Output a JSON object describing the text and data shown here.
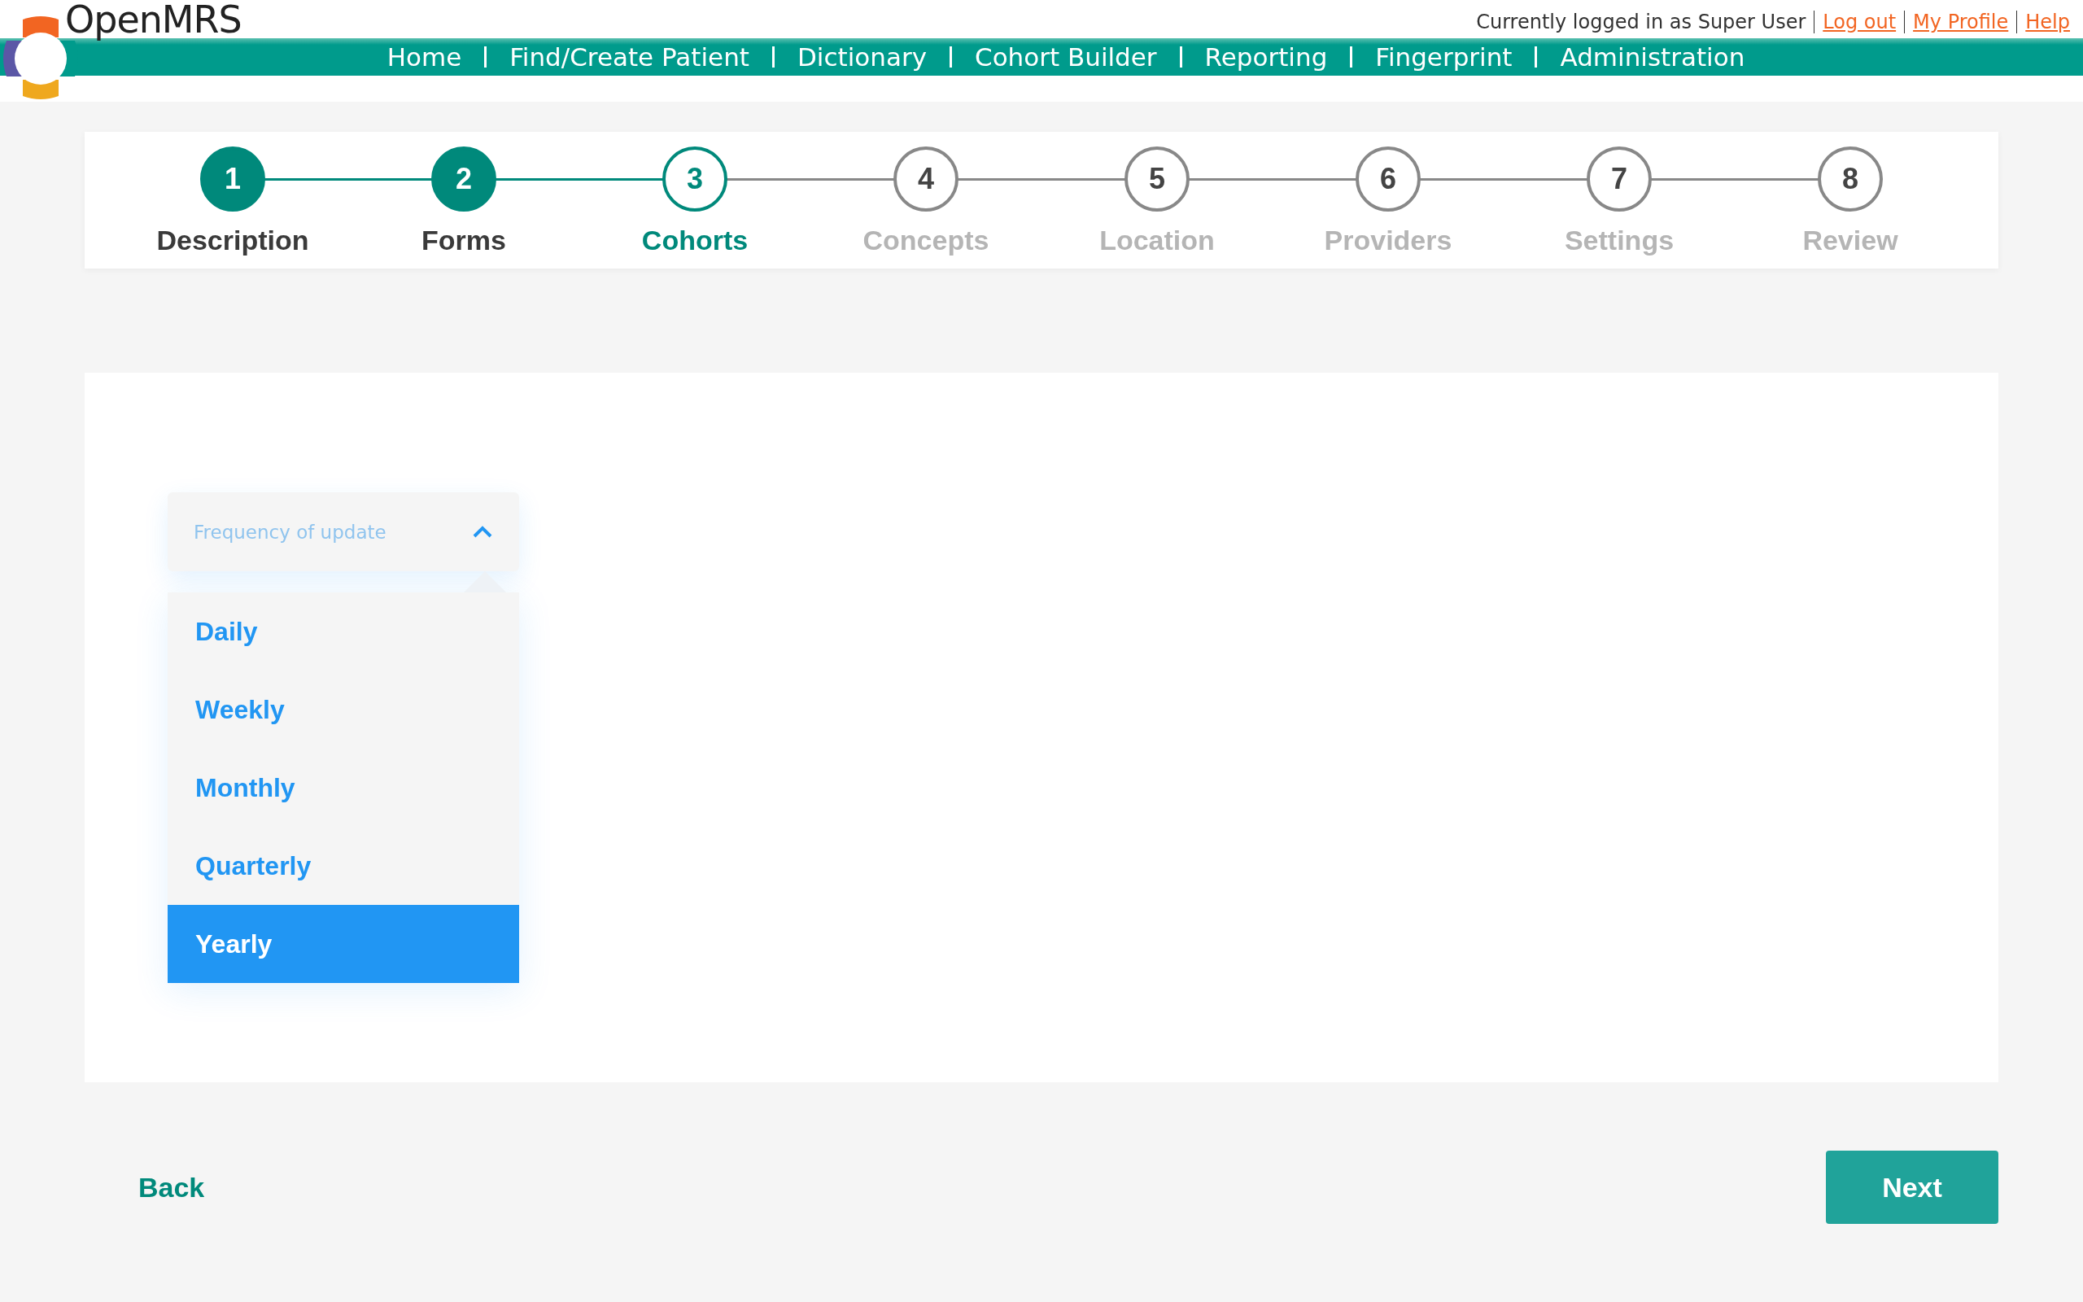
{
  "header": {
    "brand": "OpenMRS",
    "user_text": "Currently logged in as Super User",
    "links": [
      "Log out",
      "My Profile",
      "Help"
    ],
    "nav": [
      "Home",
      "Find/Create Patient",
      "Dictionary",
      "Cohort Builder",
      "Reporting",
      "Fingerprint",
      "Administration"
    ]
  },
  "steps": [
    {
      "number": "1",
      "label": "Description",
      "completed": true,
      "current": false
    },
    {
      "number": "2",
      "label": "Forms",
      "completed": true,
      "current": false
    },
    {
      "number": "3",
      "label": "Cohorts",
      "completed": false,
      "current": true
    },
    {
      "number": "4",
      "label": "Concepts",
      "completed": false,
      "current": false
    },
    {
      "number": "5",
      "label": "Location",
      "completed": false,
      "current": false
    },
    {
      "number": "6",
      "label": "Providers",
      "completed": false,
      "current": false
    },
    {
      "number": "7",
      "label": "Settings",
      "completed": false,
      "current": false
    },
    {
      "number": "8",
      "label": "Review",
      "completed": false,
      "current": false
    }
  ],
  "dropdown": {
    "placeholder": "Frequency of update",
    "expanded": true,
    "options": [
      {
        "label": "Daily",
        "selected": false
      },
      {
        "label": "Weekly",
        "selected": false
      },
      {
        "label": "Monthly",
        "selected": false
      },
      {
        "label": "Quarterly",
        "selected": false
      },
      {
        "label": "Yearly",
        "selected": true
      }
    ]
  },
  "footer": {
    "back": "Back",
    "next": "Next"
  }
}
